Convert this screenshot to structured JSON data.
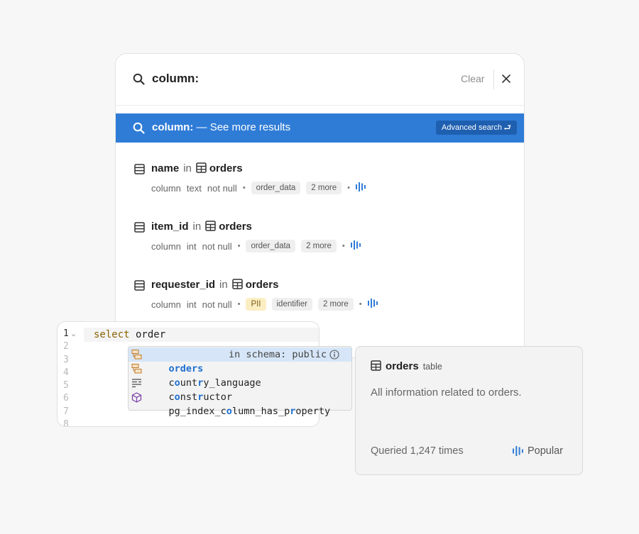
{
  "search": {
    "query": "column:",
    "clear_label": "Clear",
    "see_more_query": "column:",
    "see_more_sep": "—",
    "see_more_label": "See more results",
    "advanced_label": "Advanced search",
    "return_glyph": "⮐"
  },
  "results": [
    {
      "name": "name",
      "in": "in",
      "table": "orders",
      "kind": "column",
      "type": "text",
      "nullability": "not null",
      "tags": [
        "order_data"
      ],
      "more": "2 more"
    },
    {
      "name": "item_id",
      "in": "in",
      "table": "orders",
      "kind": "column",
      "type": "int",
      "nullability": "not null",
      "tags": [
        "order_data"
      ],
      "more": "2 more"
    },
    {
      "name": "requester_id",
      "in": "in",
      "table": "orders",
      "kind": "column",
      "type": "int",
      "nullability": "not null",
      "tags": [
        "PII",
        "identifier"
      ],
      "more": "2 more"
    }
  ],
  "editor": {
    "line_numbers": [
      "1",
      "2",
      "3",
      "4",
      "5",
      "6",
      "7",
      "8"
    ],
    "code_keyword": "select",
    "code_rest": " order"
  },
  "autocomplete": {
    "items": [
      {
        "text": "orders",
        "detail": "in schema: public",
        "icon": "table-object-icon"
      },
      {
        "text": "country_language",
        "icon": "table-object-icon"
      },
      {
        "text": "constructor",
        "icon": "text-lines-icon"
      },
      {
        "text": "pg_index_column_has_property",
        "icon": "cube-icon"
      }
    ]
  },
  "hover_card": {
    "name": "orders",
    "type": "table",
    "description": "All information related to orders.",
    "queried": "Queried 1,247 times",
    "popular": "Popular"
  },
  "colors": {
    "accent": "#2f7cd7",
    "accent_dark": "#1f5fb0",
    "popularity_bars": "#2f7cd7",
    "pii_tag": "#fbeec3"
  }
}
